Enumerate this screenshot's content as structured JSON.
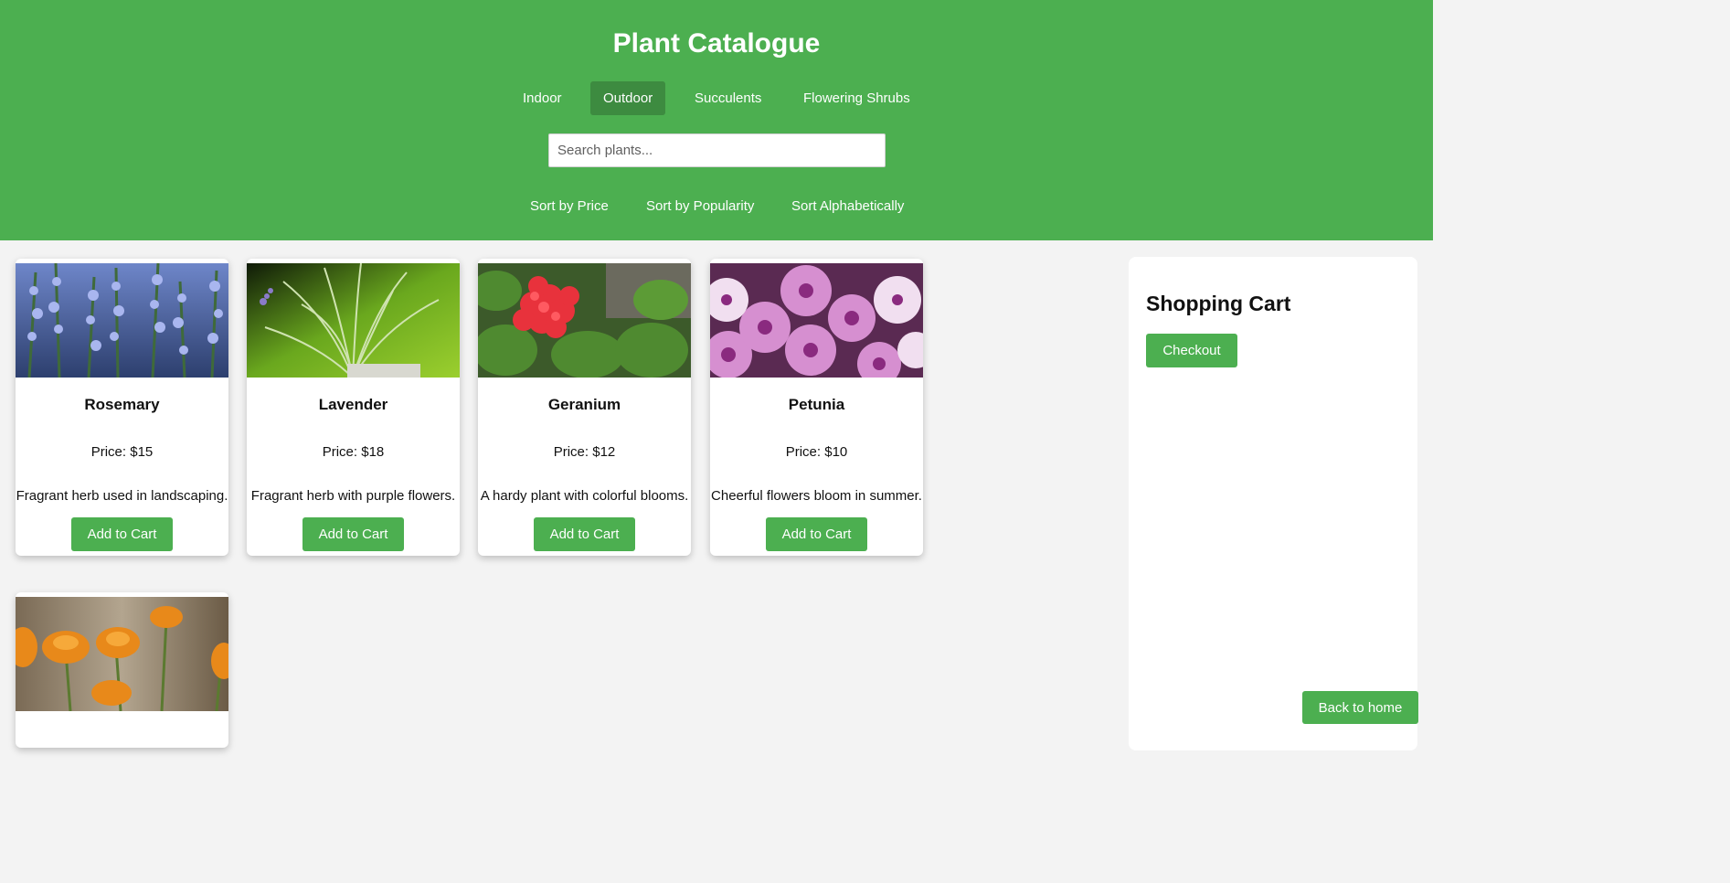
{
  "header": {
    "title": "Plant Catalogue",
    "categories": [
      {
        "label": "Indoor",
        "active": false
      },
      {
        "label": "Outdoor",
        "active": true
      },
      {
        "label": "Succulents",
        "active": false
      },
      {
        "label": "Flowering Shrubs",
        "active": false
      }
    ],
    "search": {
      "placeholder": "Search plants...",
      "value": ""
    },
    "sort": [
      "Sort by Price",
      "Sort by Popularity",
      "Sort Alphabetically"
    ]
  },
  "products": [
    {
      "name": "Rosemary",
      "price": "Price: $15",
      "description": "Fragrant herb used in landscaping.",
      "button": "Add to Cart"
    },
    {
      "name": "Lavender",
      "price": "Price: $18",
      "description": "Fragrant herb with purple flowers.",
      "button": "Add to Cart"
    },
    {
      "name": "Geranium",
      "price": "Price: $12",
      "description": "A hardy plant with colorful blooms.",
      "button": "Add to Cart"
    },
    {
      "name": "Petunia",
      "price": "Price: $10",
      "description": "Cheerful flowers bloom in summer.",
      "button": "Add to Cart"
    }
  ],
  "cart": {
    "title": "Shopping Cart",
    "checkout_label": "Checkout"
  },
  "back_label": "Back to home",
  "colors": {
    "brand": "#4caf50",
    "active_tab": "#3d8b40",
    "page_bg": "#f3f3f3"
  }
}
